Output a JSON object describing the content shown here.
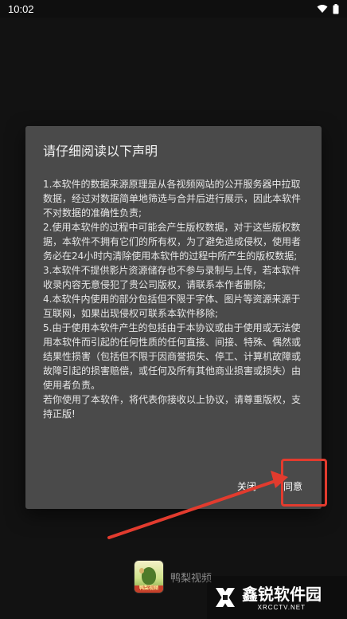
{
  "status_bar": {
    "time": "10:02"
  },
  "dialog": {
    "title": "请仔细阅读以下声明",
    "body": "1.本软件的数据来源原理是从各视频网站的公开服务器中拉取数据，经过对数据简单地筛选与合并后进行展示，因此本软件不对数据的准确性负责;\n2.使用本软件的过程中可能会产生版权数据，对于这些版权数据，本软件不拥有它们的所有权，为了避免造成侵权，使用者务必在24小时内清除使用本软件的过程中所产生的版权数据;\n3.本软件不提供影片资源储存也不参与录制与上传，若本软件收录内容无意侵犯了贵公司版权，请联系本作者删除;\n4.本软件内使用的部分包括但不限于字体、图片等资源来源于互联网，如果出现侵权可联系本软件移除;\n5.由于使用本软件产生的包括由于本协议或由于使用或无法使用本软件而引起的任何性质的任何直接、间接、特殊、偶然或结果性损害（包括但不限于因商誉损失、停工、计算机故障或故障引起的损害赔偿，或任何及所有其他商业损害或损失）由使用者负责。\n若你使用了本软件，将代表你接收以上协议，请尊重版权，支持正版!",
    "cancel_label": "关闭",
    "agree_label": "同意"
  },
  "app": {
    "name": "鸭梨视频",
    "icon_tag": "鸭梨视频"
  },
  "watermark": {
    "name": "鑫锐软件园",
    "url": "XRCCTV.NET"
  },
  "colors": {
    "dialog_bg": "#4a4a4a",
    "highlight": "#e23b2e"
  }
}
